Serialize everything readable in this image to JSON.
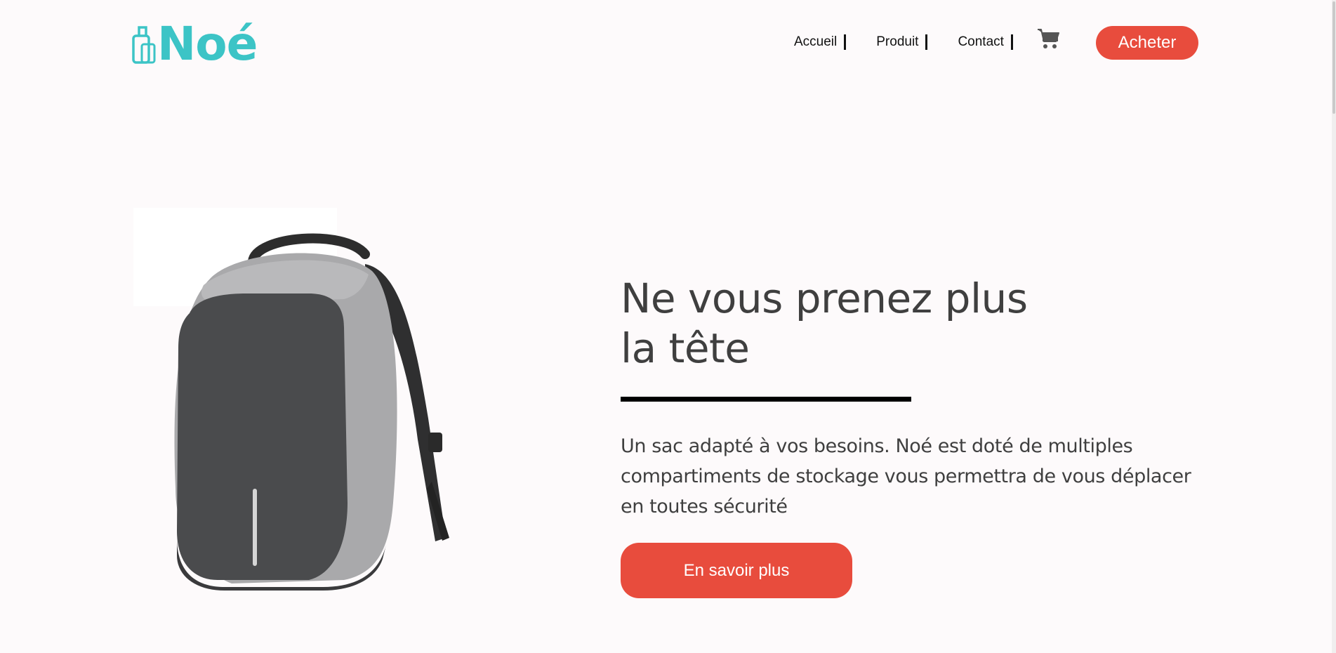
{
  "brand": {
    "name": "Noé",
    "color": "#3cc4c6",
    "logo_icon": "luggage-icon"
  },
  "nav": {
    "items": [
      {
        "label": "Accueil"
      },
      {
        "label": "Produit"
      },
      {
        "label": "Contact"
      }
    ],
    "cart_icon": "cart-icon",
    "buy_label": "Acheter"
  },
  "hero": {
    "title_line1": "Ne vous prenez plus",
    "title_line2": "la tête",
    "description_line1": "Un sac adapté à vos besoins. Noé est doté de multiples",
    "description_line2": "compartiments de stockage vous permettra de vous déplacer",
    "description_line3": "en toutes sécurité",
    "cta_label": "En savoir plus",
    "image": "backpack-image"
  },
  "colors": {
    "accent": "#e84c3d",
    "background": "#fdfafb",
    "text": "#3f3f3f"
  }
}
